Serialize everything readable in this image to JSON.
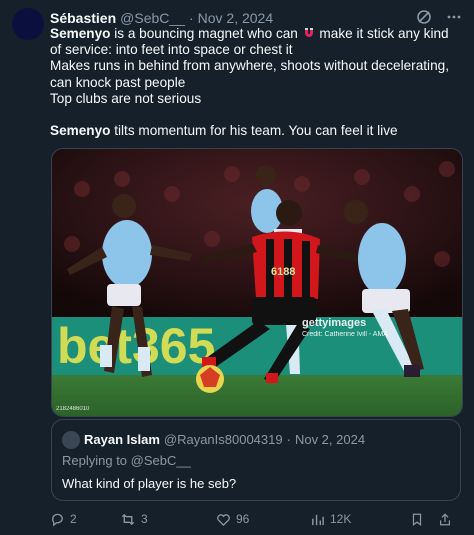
{
  "tweet": {
    "author_name": "Sébastien",
    "handle": "@SebC__",
    "separator": "·",
    "date": "Nov 2, 2024",
    "line1_bold": "Semenyo",
    "line1_rest": " is a bouncing magnet who can ",
    "line1_after": " make it stick any kind of service: into feet into space or chest it",
    "line2": "Makes runs in behind from anywhere, shoots without decelerating, can knock past people",
    "line3": "Top clubs are not serious",
    "line4_bold": "Semenyo",
    "line4_rest": " tilts momentum for his team. You can feel it live"
  },
  "media": {
    "watermark_brand": "gettyimages",
    "watermark_credit": "Credit: Catherine Ivill - AMA",
    "image_id": "2182486010",
    "board_text": "bet365",
    "shirt_number_front": "6188"
  },
  "quote": {
    "author_name": "Rayan Islam",
    "handle": "@RayanIs80004319",
    "separator": "·",
    "date": "Nov 2, 2024",
    "replying_to": "Replying to @SebC__",
    "text": "What kind of player is he seb?"
  },
  "actions": {
    "replies": "2",
    "retweets": "3",
    "likes": "96",
    "views": "12K"
  },
  "colors": {
    "background": "#15202b",
    "muted": "#8b98a5",
    "border": "#38444d"
  }
}
